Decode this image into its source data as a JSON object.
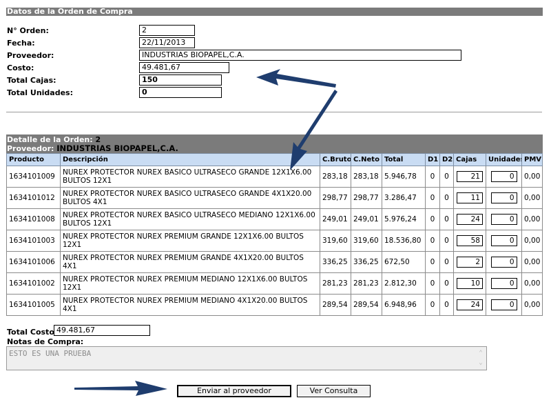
{
  "header": {
    "title": "Datos de la Orden de Compra"
  },
  "form": {
    "orden_label": "N° Orden:",
    "orden_value": "2",
    "fecha_label": "Fecha:",
    "fecha_value": "22/11/2013",
    "proveedor_label": "Proveedor:",
    "proveedor_value": "INDUSTRIAS BIOPAPEL,C.A.",
    "costo_label": "Costo:",
    "costo_value": "49.481,67",
    "cajas_label": "Total Cajas:",
    "cajas_value": "150",
    "unidades_label": "Total Unidades:",
    "unidades_value": "0"
  },
  "detail": {
    "title_prefix": "Detalle de la Orden:",
    "orden": "2",
    "proveedor_prefix": "Proveedor:",
    "proveedor": "INDUSTRIAS BIOPAPEL,C.A."
  },
  "table": {
    "columns": [
      "Producto",
      "Descripción",
      "C.Bruto",
      "C.Neto",
      "Total",
      "D1",
      "D2",
      "Cajas",
      "Unidades",
      "PMV"
    ],
    "rows": [
      {
        "producto": "1634101009",
        "descripcion": "NUREX PROTECTOR NUREX BASICO ULTRASECO GRANDE 12X1X6.00 BULTOS 12X1",
        "bruto": "283,18",
        "neto": "283,18",
        "total": "5.946,78",
        "d1": "0",
        "d2": "0",
        "cajas": "21",
        "unidades": "0",
        "pmv": "0,00"
      },
      {
        "producto": "1634101012",
        "descripcion": "NUREX PROTECTOR NUREX BASICO ULTRASECO GRANDE 4X1X20.00 BULTOS 4X1",
        "bruto": "298,77",
        "neto": "298,77",
        "total": "3.286,47",
        "d1": "0",
        "d2": "0",
        "cajas": "11",
        "unidades": "0",
        "pmv": "0,00"
      },
      {
        "producto": "1634101008",
        "descripcion": "NUREX PROTECTOR NUREX BASICO ULTRASECO MEDIANO 12X1X6.00 BULTOS 12X1",
        "bruto": "249,01",
        "neto": "249,01",
        "total": "5.976,24",
        "d1": "0",
        "d2": "0",
        "cajas": "24",
        "unidades": "0",
        "pmv": "0,00"
      },
      {
        "producto": "1634101003",
        "descripcion": "NUREX PROTECTOR NUREX PREMIUM GRANDE 12X1X6.00 BULTOS 12X1",
        "bruto": "319,60",
        "neto": "319,60",
        "total": "18.536,80",
        "d1": "0",
        "d2": "0",
        "cajas": "58",
        "unidades": "0",
        "pmv": "0,00"
      },
      {
        "producto": "1634101006",
        "descripcion": "NUREX PROTECTOR NUREX PREMIUM GRANDE 4X1X20.00 BULTOS 4X1",
        "bruto": "336,25",
        "neto": "336,25",
        "total": "672,50",
        "d1": "0",
        "d2": "0",
        "cajas": "2",
        "unidades": "0",
        "pmv": "0,00"
      },
      {
        "producto": "1634101002",
        "descripcion": "NUREX PROTECTOR NUREX PREMIUM MEDIANO 12X1X6.00 BULTOS 12X1",
        "bruto": "281,23",
        "neto": "281,23",
        "total": "2.812,30",
        "d1": "0",
        "d2": "0",
        "cajas": "10",
        "unidades": "0",
        "pmv": "0,00"
      },
      {
        "producto": "1634101005",
        "descripcion": "NUREX PROTECTOR NUREX PREMIUM MEDIANO 4X1X20.00 BULTOS 4X1",
        "bruto": "289,54",
        "neto": "289,54",
        "total": "6.948,96",
        "d1": "0",
        "d2": "0",
        "cajas": "24",
        "unidades": "0",
        "pmv": "0,00"
      }
    ]
  },
  "footer": {
    "total_costo_label": "Total Costo:",
    "total_costo_value": "49.481,67",
    "notas_label": "Notas de Compra:",
    "notas_value": "ESTO ES UNA PRUEBA",
    "enviar_label": "Enviar al proveedor",
    "consulta_label": "Ver Consulta"
  },
  "colors": {
    "bar": "#7b7b7b",
    "header_row": "#c9dcf3",
    "arrow": "#1f3d6e"
  }
}
